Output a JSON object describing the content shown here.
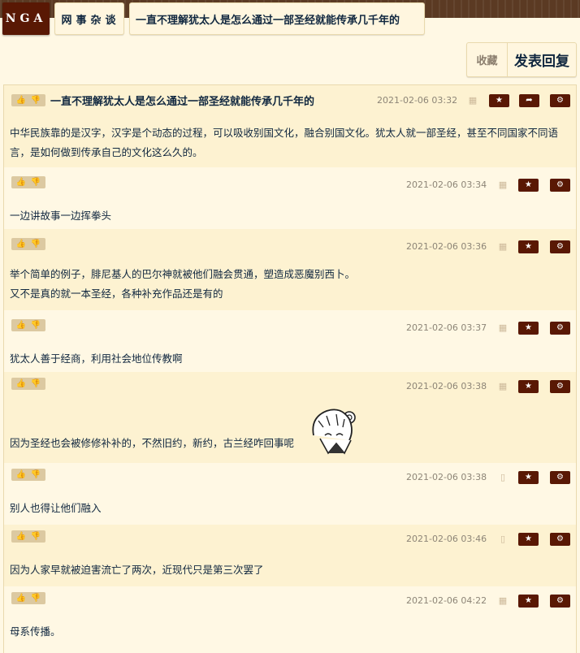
{
  "logo": "NGA",
  "breadcrumb": {
    "board": "网事杂谈",
    "thread": "一直不理解犹太人是怎么通过一部圣经就能传承几千年的"
  },
  "actions": {
    "favorite": "收藏",
    "reply": "发表回复"
  },
  "icons": {
    "star": "star-icon",
    "share": "share-icon",
    "gear": "gear-icon",
    "device_android": "android-icon",
    "device_phone": "phone-icon",
    "thumbs": "thumbs-up-down-icon"
  },
  "colors": {
    "accent": "#591804",
    "row_a": "#fdf2d1",
    "row_b": "#fff8e4",
    "text": "#10273f"
  },
  "posts": [
    {
      "title": "一直不理解犹太人是怎么通过一部圣经就能传承几千年的",
      "time": "2021-02-06 03:32",
      "device": "android",
      "lines": [
        "中华民族靠的是汉字，汉字是个动态的过程，可以吸收别国文化，融合别国文化。犹太人就一部圣经，甚至不同国家不同语言，是如何做到传承自己的文化这么久的。"
      ]
    },
    {
      "time": "2021-02-06 03:34",
      "device": "android",
      "lines": [
        "一边讲故事一边挥拳头"
      ]
    },
    {
      "time": "2021-02-06 03:36",
      "device": "android",
      "lines": [
        "举个简单的例子，腓尼基人的巴尔神就被他们融会贯通，塑造成恶魔别西卜。",
        "又不是真的就一本圣经，各种补充作品还是有的"
      ]
    },
    {
      "time": "2021-02-06 03:37",
      "device": "android",
      "lines": [
        "犹太人善于经商，利用社会地位传教啊"
      ]
    },
    {
      "time": "2021-02-06 03:38",
      "device": "android",
      "lines": [
        "因为圣经也会被修修补补的，不然旧约，新约，古兰经咋回事呢"
      ]
    },
    {
      "time": "2021-02-06 03:38",
      "device": "phone",
      "lines": [
        "别人也得让他们融入"
      ]
    },
    {
      "time": "2021-02-06 03:46",
      "device": "phone",
      "lines": [
        "因为人家早就被迫害流亡了两次，近现代只是第三次罢了"
      ]
    },
    {
      "time": "2021-02-06 04:22",
      "device": "android",
      "lines": [
        "母系传播。"
      ]
    }
  ]
}
